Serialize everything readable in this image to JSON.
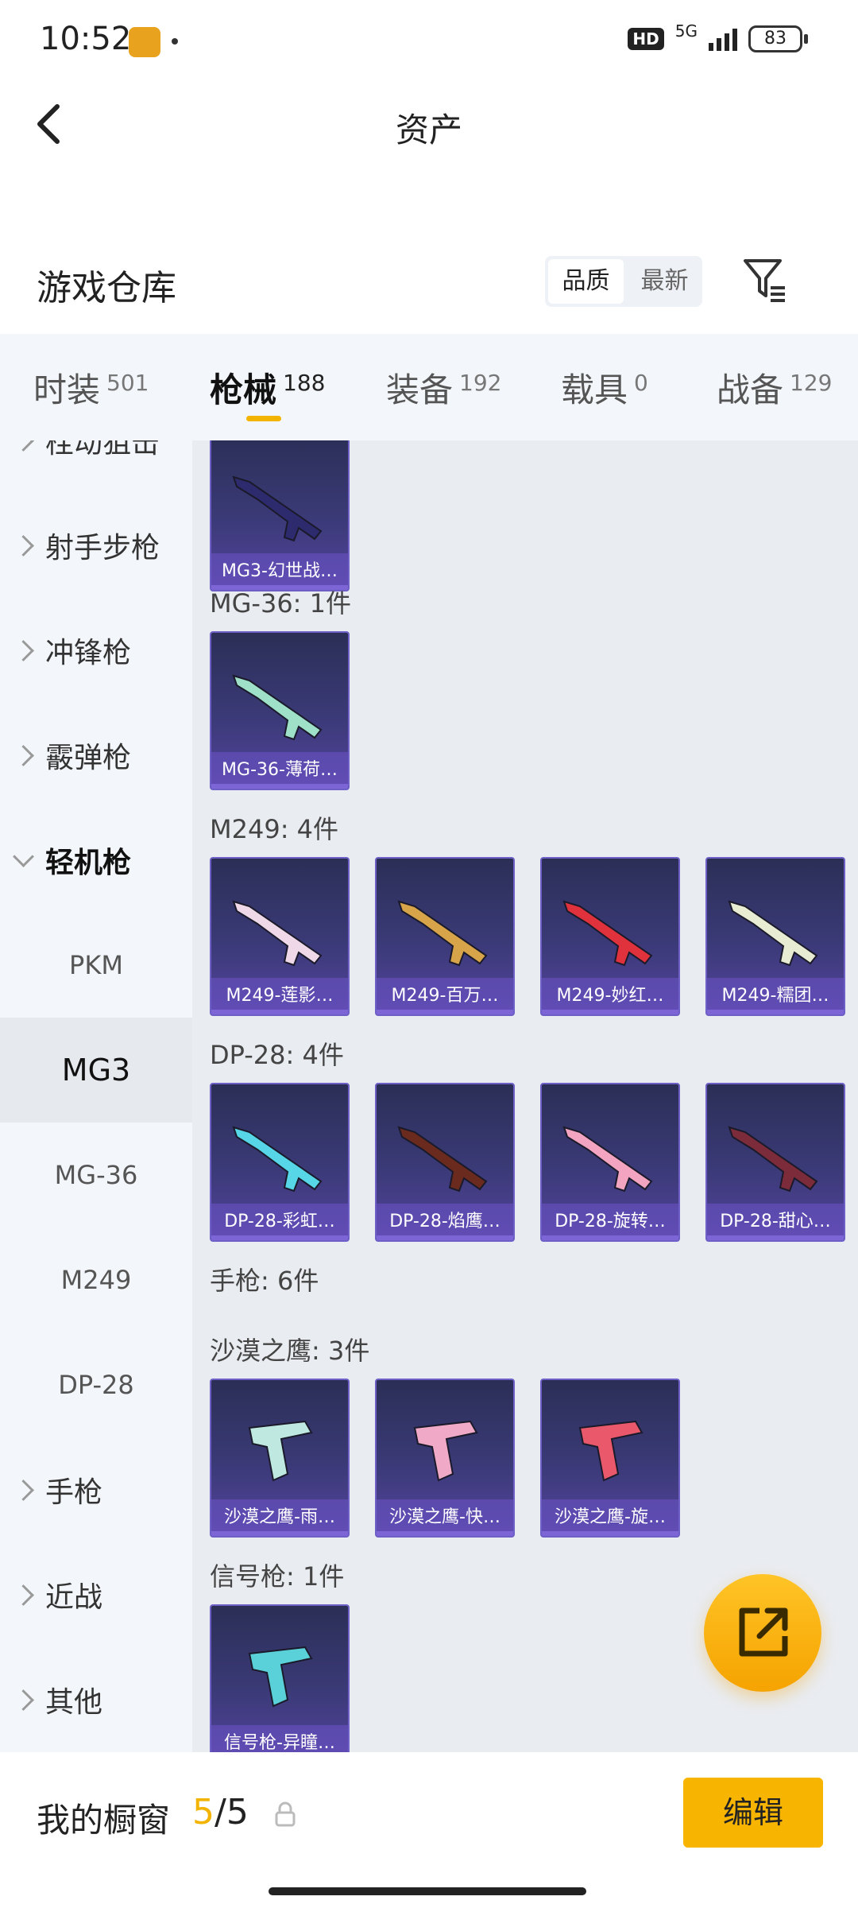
{
  "status": {
    "time": "10:52",
    "hd": "HD",
    "network": "5G",
    "battery": "83"
  },
  "header": {
    "title": "资产"
  },
  "warehouse": {
    "title": "游戏仓库",
    "sort_options": [
      "品质",
      "最新"
    ],
    "active_sort": "品质"
  },
  "tabs": [
    {
      "label": "时装",
      "count": "501"
    },
    {
      "label": "枪械",
      "count": "188"
    },
    {
      "label": "装备",
      "count": "192"
    },
    {
      "label": "载具",
      "count": "0"
    },
    {
      "label": "战备",
      "count": "129"
    }
  ],
  "sidebar": {
    "items": [
      {
        "label": "栓动狙击"
      },
      {
        "label": "射手步枪"
      },
      {
        "label": "冲锋枪"
      },
      {
        "label": "霰弹枪"
      },
      {
        "label": "轻机枪"
      }
    ],
    "sub_items": [
      "PKM",
      "MG3",
      "MG-36",
      "M249",
      "DP-28"
    ],
    "selected_sub": "MG3",
    "tail_items": [
      {
        "label": "手枪"
      },
      {
        "label": "近战"
      },
      {
        "label": "其他"
      }
    ]
  },
  "content": {
    "groups": [
      {
        "title": "",
        "items": [
          {
            "label": "MG3-幻世战…",
            "color": "#2d2a6e"
          }
        ]
      },
      {
        "title": "MG-36: 1件",
        "items": [
          {
            "label": "MG-36-薄荷…",
            "color": "#9fe0c9"
          }
        ]
      },
      {
        "title": "M249: 4件",
        "items": [
          {
            "label": "M249-莲影…",
            "color": "#efd9e8"
          },
          {
            "label": "M249-百万…",
            "color": "#d8a44a"
          },
          {
            "label": "M249-妙红…",
            "color": "#e0323c"
          },
          {
            "label": "M249-糯团…",
            "color": "#e7ecd2"
          }
        ]
      },
      {
        "title": "DP-28: 4件",
        "items": [
          {
            "label": "DP-28-彩虹…",
            "color": "#56d6e6"
          },
          {
            "label": "DP-28-焰鹰…",
            "color": "#6b2a1e"
          },
          {
            "label": "DP-28-旋转…",
            "color": "#f2a4c0"
          },
          {
            "label": "DP-28-甜心…",
            "color": "#7b2b3a"
          }
        ]
      },
      {
        "title": "手枪: 6件",
        "items": []
      },
      {
        "title": "沙漠之鹰: 3件",
        "items": [
          {
            "label": "沙漠之鹰-雨…",
            "color": "#bfe9e0"
          },
          {
            "label": "沙漠之鹰-快…",
            "color": "#f0a9c6"
          },
          {
            "label": "沙漠之鹰-旋…",
            "color": "#e9596b"
          }
        ]
      },
      {
        "title": "信号枪: 1件",
        "items": [
          {
            "label": "信号枪-异瞳…",
            "color": "#5ad0d8"
          }
        ]
      }
    ]
  },
  "bottom": {
    "showcase_label": "我的橱窗",
    "showcase_used": "5",
    "showcase_sep": "/",
    "showcase_total": "5",
    "edit_label": "编辑"
  },
  "colors": {
    "accent": "#f7b400",
    "card_bg": "#3b3a78"
  },
  "icons": {
    "back": "back-arrow-icon",
    "filter": "filter-icon",
    "share": "share-external-icon",
    "lock": "lock-icon"
  }
}
